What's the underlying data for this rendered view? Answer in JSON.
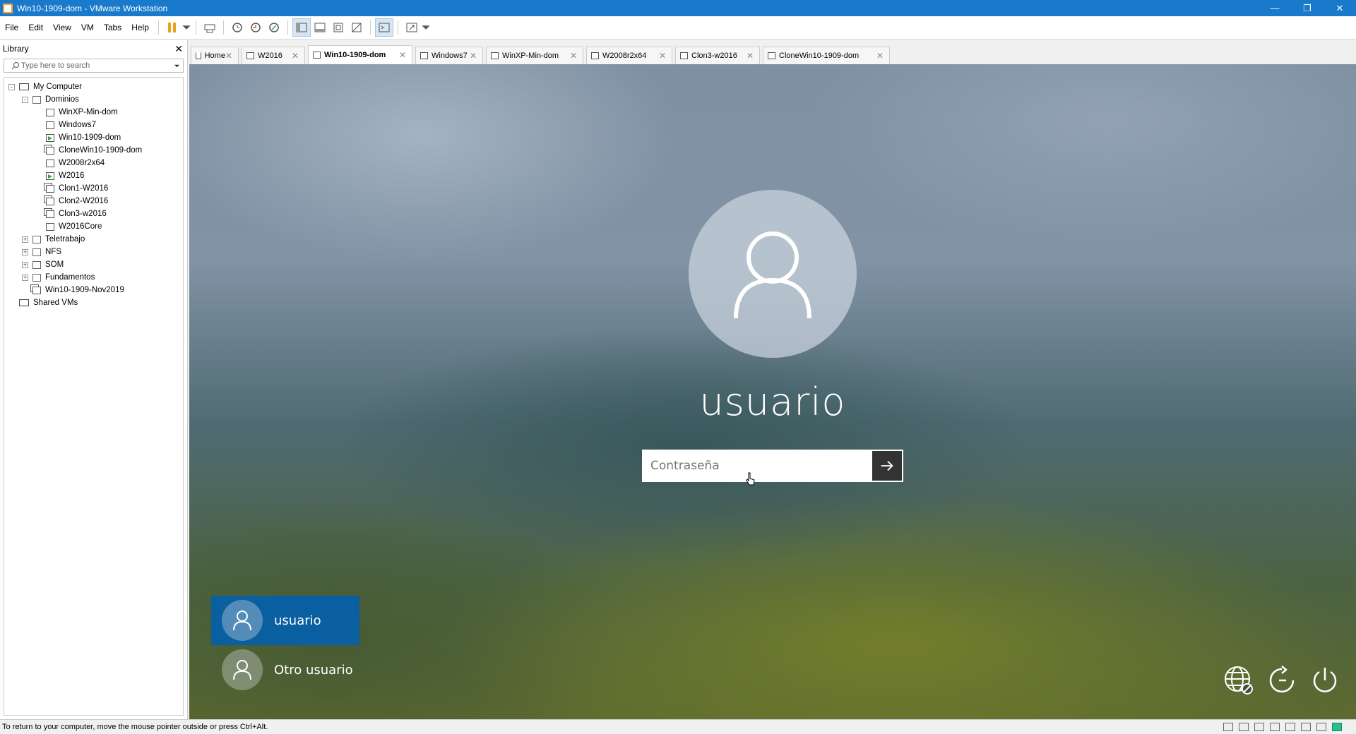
{
  "window": {
    "title": "Win10-1909-dom - VMware Workstation"
  },
  "menu": [
    "File",
    "Edit",
    "View",
    "VM",
    "Tabs",
    "Help"
  ],
  "library": {
    "title": "Library",
    "search_placeholder": "Type here to search",
    "tree": [
      {
        "label": "My Computer",
        "icon": "computer-icon",
        "level": 0,
        "expander": "-"
      },
      {
        "label": "Dominios",
        "icon": "folder-icon",
        "level": 1,
        "expander": "-"
      },
      {
        "label": "WinXP-Min-dom",
        "icon": "vm-icon",
        "level": 2,
        "expander": ""
      },
      {
        "label": "Windows7",
        "icon": "vm-icon",
        "level": 2,
        "expander": ""
      },
      {
        "label": "Win10-1909-dom",
        "icon": "vm-running-icon",
        "level": 2,
        "expander": ""
      },
      {
        "label": "CloneWin10-1909-dom",
        "icon": "vm-clone-icon",
        "level": 2,
        "expander": ""
      },
      {
        "label": "W2008r2x64",
        "icon": "vm-icon",
        "level": 2,
        "expander": ""
      },
      {
        "label": "W2016",
        "icon": "vm-running-icon",
        "level": 2,
        "expander": ""
      },
      {
        "label": "Clon1-W2016",
        "icon": "vm-clone-icon",
        "level": 2,
        "expander": ""
      },
      {
        "label": "Clon2-W2016",
        "icon": "vm-clone-icon",
        "level": 2,
        "expander": ""
      },
      {
        "label": "Clon3-w2016",
        "icon": "vm-clone-icon",
        "level": 2,
        "expander": ""
      },
      {
        "label": "W2016Core",
        "icon": "vm-icon",
        "level": 2,
        "expander": ""
      },
      {
        "label": "Teletrabajo",
        "icon": "folder-icon",
        "level": 1,
        "expander": "+"
      },
      {
        "label": "NFS",
        "icon": "folder-icon",
        "level": 1,
        "expander": "+"
      },
      {
        "label": "SOM",
        "icon": "folder-icon",
        "level": 1,
        "expander": "+"
      },
      {
        "label": "Fundamentos",
        "icon": "folder-icon",
        "level": 1,
        "expander": "+"
      },
      {
        "label": "Win10-1909-Nov2019",
        "icon": "vm-clone-icon",
        "level": 1,
        "expander": ""
      },
      {
        "label": "Shared VMs",
        "icon": "shared-vms-icon",
        "level": 0,
        "expander": ""
      }
    ]
  },
  "tabs": [
    {
      "label": "Home",
      "icon": "home-icon",
      "active": false
    },
    {
      "label": "W2016",
      "icon": "vm-running-icon",
      "active": false
    },
    {
      "label": "Win10-1909-dom",
      "icon": "vm-running-icon",
      "active": true
    },
    {
      "label": "Windows7",
      "icon": "vm-icon",
      "active": false
    },
    {
      "label": "WinXP-Min-dom",
      "icon": "vm-icon",
      "active": false
    },
    {
      "label": "W2008r2x64",
      "icon": "vm-icon",
      "active": false
    },
    {
      "label": "Clon3-w2016",
      "icon": "vm-clone-icon",
      "active": false
    },
    {
      "label": "CloneWin10-1909-dom",
      "icon": "vm-clone-icon",
      "active": false
    }
  ],
  "login": {
    "username": "usuario",
    "password_placeholder": "Contraseña",
    "users": [
      {
        "label": "usuario",
        "selected": true
      },
      {
        "label": "Otro usuario",
        "selected": false
      }
    ]
  },
  "status": {
    "text": "To return to your computer, move the mouse pointer outside or press Ctrl+Alt."
  },
  "colors": {
    "titlebar": "#1979ca",
    "selected_user": "#0a5fa0"
  }
}
